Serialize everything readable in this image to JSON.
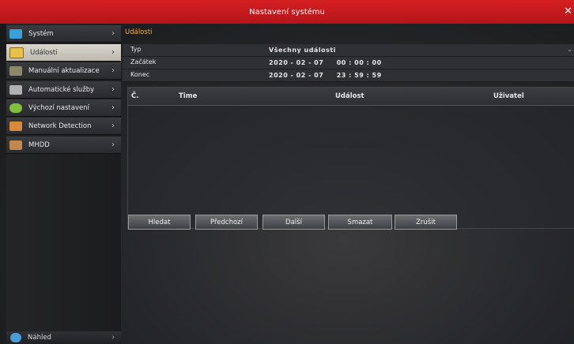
{
  "title": "Nastavení systému",
  "sidebar": {
    "items": [
      {
        "label": "Systém",
        "icon": "monitor-icon",
        "color": "#3aa0d8"
      },
      {
        "label": "Události",
        "icon": "folder-icon",
        "color": "#e8c14a",
        "active": true
      },
      {
        "label": "Manuální aktualizace",
        "icon": "update-icon",
        "color": "#8a8a6a"
      },
      {
        "label": "Automatické služby",
        "icon": "tools-icon",
        "color": "#b0b0b0"
      },
      {
        "label": "Výchozí nastavení",
        "icon": "refresh-icon",
        "color": "#7fbf3a"
      },
      {
        "label": "Network Detection",
        "icon": "network-icon",
        "color": "#d88a3a"
      },
      {
        "label": "MHDD",
        "icon": "disk-icon",
        "color": "#c08850"
      }
    ],
    "bottom": {
      "label": "Náhled",
      "icon": "preview-icon"
    }
  },
  "events": {
    "section_title": "Události",
    "fields": [
      {
        "label": "Typ",
        "value": "Všechny události"
      },
      {
        "label": "Začátek",
        "value": "2020 - 02 - 07     00 : 00 : 00"
      },
      {
        "label": "Konec",
        "value": "2020 - 02 - 07     23 : 59 : 59"
      }
    ],
    "columns": [
      "Č.",
      "Time",
      "Událost",
      "Uživatel"
    ]
  },
  "buttons": [
    "Hledat",
    "Předchozí",
    "Další",
    "Smazat",
    "Zrušit"
  ]
}
